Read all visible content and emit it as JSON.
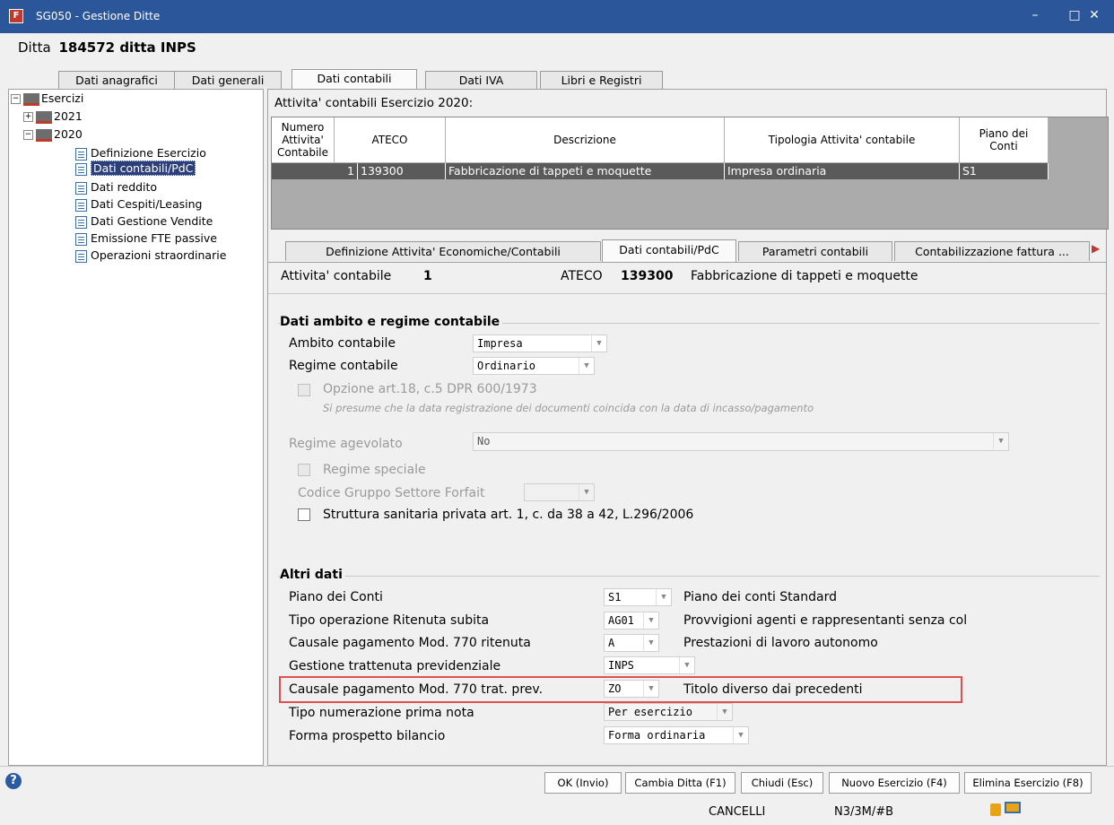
{
  "window": {
    "title": "SG050 - Gestione Ditte",
    "minimize_label": "–",
    "maximize_label": "□",
    "close_label": "✕"
  },
  "ditta": {
    "label": "Ditta",
    "value": "184572 ditta INPS"
  },
  "tabs": [
    "Dati anagrafici",
    "Dati generali",
    "Dati contabili",
    "Dati IVA",
    "Libri e Registri"
  ],
  "tree": {
    "root": "Esercizi",
    "years": [
      "2021",
      "2020"
    ],
    "items": [
      "Definizione Esercizio",
      "Dati contabili/PdC",
      "Dati reddito",
      "Dati Cespiti/Leasing",
      "Dati Gestione Vendite",
      "Emissione FTE passive",
      "Operazioni straordinarie"
    ]
  },
  "grid": {
    "caption": "Attivita' contabili Esercizio 2020:",
    "headers": [
      "Numero\nAttivita'\nContabile",
      "ATECO",
      "Descrizione",
      "Tipologia Attivita' contabile",
      "Piano dei\nConti"
    ],
    "row": [
      "1",
      "139300",
      "Fabbricazione di tappeti e moquette",
      "Impresa ordinaria",
      "S1"
    ]
  },
  "subtabs": [
    "Definizione Attivita' Economiche/Contabili",
    "Dati contabili/PdC",
    "Parametri contabili",
    "Contabilizzazione fattura ..."
  ],
  "activity": {
    "label": "Attivita' contabile",
    "number": "1",
    "ateco_label": "ATECO",
    "ateco_code": "139300",
    "ateco_desc": "Fabbricazione di tappeti e moquette"
  },
  "sec1": {
    "title": "Dati ambito e regime contabile",
    "ambito_label": "Ambito contabile",
    "ambito_value": "Impresa",
    "regime_label": "Regime contabile",
    "regime_value": "Ordinario",
    "opzione_label": "Opzione art.18, c.5 DPR 600/1973",
    "opzione_note": "Si presume che la data registrazione dei documenti coincida con la data di incasso/pagamento",
    "agevolato_label": "Regime agevolato",
    "agevolato_value": "No",
    "speciale_label": "Regime speciale",
    "forfait_label": "Codice Gruppo Settore Forfait",
    "forfait_value": "",
    "sanitaria_label": "Struttura sanitaria privata art. 1, c. da 38 a 42, L.296/2006"
  },
  "sec2": {
    "title": "Altri dati",
    "rows": [
      {
        "label": "Piano dei Conti",
        "value": "S1",
        "desc": "Piano dei conti Standard"
      },
      {
        "label": "Tipo operazione Ritenuta subita",
        "value": "AG01",
        "desc": "Provvigioni agenti e rappresentanti senza col"
      },
      {
        "label": "Causale pagamento Mod. 770 ritenuta",
        "value": "A",
        "desc": "Prestazioni di lavoro autonomo"
      },
      {
        "label": "Gestione trattenuta previdenziale",
        "value": "INPS",
        "desc": ""
      },
      {
        "label": "Causale pagamento Mod. 770 trat. prev.",
        "value": "ZO",
        "desc": "Titolo diverso dai precedenti"
      },
      {
        "label": "Tipo numerazione prima nota",
        "value": "Per esercizio",
        "desc": ""
      },
      {
        "label": "Forma prospetto bilancio",
        "value": "Forma ordinaria",
        "desc": ""
      }
    ]
  },
  "buttons": [
    "OK (Invio)",
    "Cambia Ditta (F1)",
    "Chiudi (Esc)",
    "Nuovo Esercizio (F4)",
    "Elimina Esercizio (F8)"
  ],
  "status": {
    "user": "CANCELLI",
    "code": "N3/3M/#B"
  },
  "icons": {
    "help": "?",
    "arrow_right": "▶"
  }
}
